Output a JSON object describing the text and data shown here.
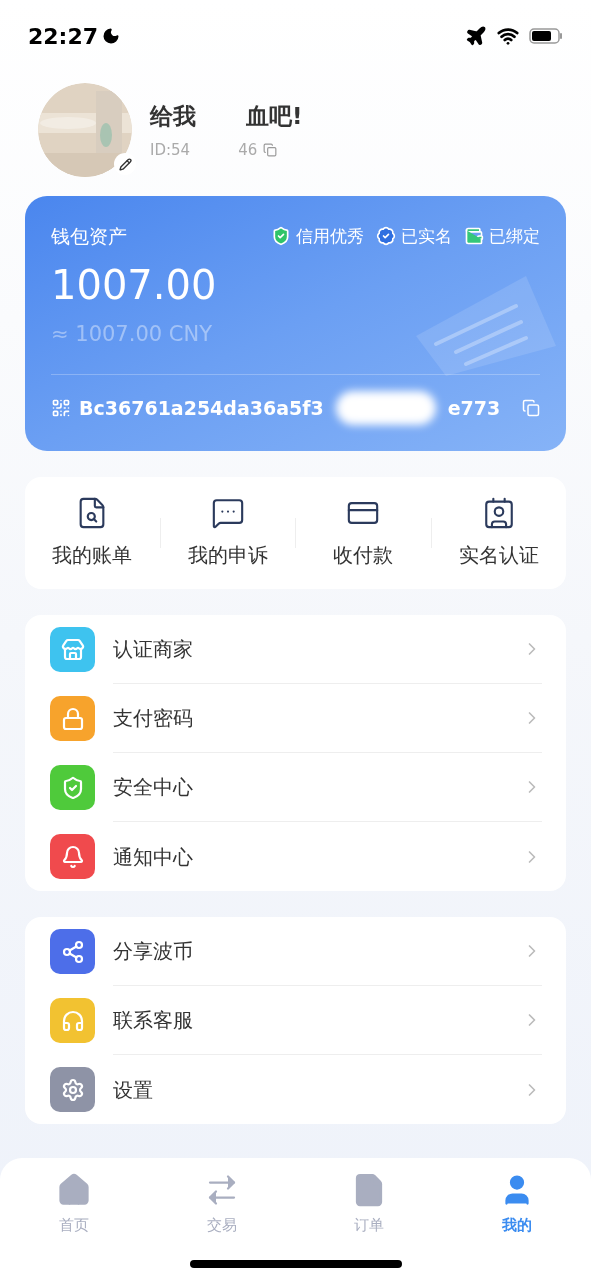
{
  "status_bar": {
    "time": "22:27"
  },
  "profile": {
    "name_parts": [
      "给我",
      "血吧!"
    ],
    "id_parts": [
      "ID:54",
      "46"
    ]
  },
  "wallet": {
    "title": "钱包资产",
    "badges": [
      {
        "label": "信用优秀",
        "color": "#2fc46a"
      },
      {
        "label": "已实名",
        "color": "#2f6fe0"
      },
      {
        "label": "已绑定",
        "color": "#34c77a"
      }
    ],
    "amount": "1007.00",
    "converted": "≈ 1007.00 CNY",
    "address_parts": [
      "Bc36761a254da36a5f3",
      "e773"
    ]
  },
  "quick_actions": [
    {
      "label": "我的账单"
    },
    {
      "label": "我的申诉"
    },
    {
      "label": "收付款"
    },
    {
      "label": "实名认证"
    }
  ],
  "menu_groups": [
    [
      {
        "label": "认证商家",
        "color": "#3ec3ef"
      },
      {
        "label": "支付密码",
        "color": "#f7a32c"
      },
      {
        "label": "安全中心",
        "color": "#4fca3b"
      },
      {
        "label": "通知中心",
        "color": "#f04a4d"
      }
    ],
    [
      {
        "label": "分享波币",
        "color": "#4d6ee9"
      },
      {
        "label": "联系客服",
        "color": "#f2c231"
      },
      {
        "label": "设置",
        "color": "#8e93a6"
      }
    ]
  ],
  "tab_bar": [
    {
      "label": "首页",
      "selected": false
    },
    {
      "label": "交易",
      "selected": false
    },
    {
      "label": "订单",
      "selected": false
    },
    {
      "label": "我的",
      "selected": true
    }
  ]
}
